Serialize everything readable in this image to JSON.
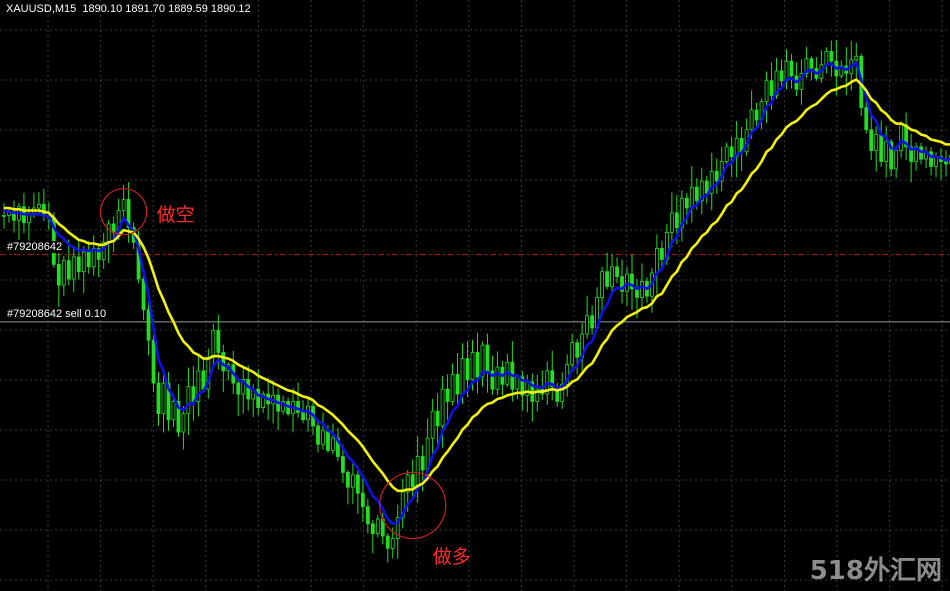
{
  "header": {
    "symbol": "XAUUSD,M15",
    "open": "1890.10",
    "high": "1891.70",
    "low": "1889.59",
    "close": "1890.12"
  },
  "orders": [
    {
      "label": "#79208642",
      "value": 1891.0,
      "color": "#b01010",
      "style": "dash-dot"
    },
    {
      "label": "#79208642 sell 0.10",
      "value": 1885.5,
      "color": "#9a9a9a",
      "style": "solid"
    }
  ],
  "annotations": [
    {
      "text": "做空",
      "x_index": 24,
      "y": 1894.5
    },
    {
      "text": "做多",
      "x_index": 82,
      "y": 1870.5
    }
  ],
  "watermark": "518外汇网",
  "chart_data": {
    "type": "candlestick",
    "instrument": "XAUUSD",
    "timeframe": "M15",
    "ylim": [
      1864,
      1910
    ],
    "grid": true,
    "bull_color": "#22dd22",
    "bear_color": "#22dd22",
    "grid_color": "#3a3a3a",
    "x": [
      0,
      1,
      2,
      3,
      4,
      5,
      6,
      7,
      8,
      9,
      10,
      11,
      12,
      13,
      14,
      15,
      16,
      17,
      18,
      19,
      20,
      21,
      22,
      23,
      24,
      25,
      26,
      27,
      28,
      29,
      30,
      31,
      32,
      33,
      34,
      35,
      36,
      37,
      38,
      39,
      40,
      41,
      42,
      43,
      44,
      45,
      46,
      47,
      48,
      49,
      50,
      51,
      52,
      53,
      54,
      55,
      56,
      57,
      58,
      59,
      60,
      61,
      62,
      63,
      64,
      65,
      66,
      67,
      68,
      69,
      70,
      71,
      72,
      73,
      74,
      75,
      76,
      77,
      78,
      79,
      80,
      81,
      82,
      83,
      84,
      85,
      86,
      87,
      88,
      89,
      90,
      91,
      92,
      93,
      94,
      95,
      96,
      97,
      98,
      99,
      100,
      101,
      102,
      103,
      104,
      105,
      106,
      107,
      108,
      109,
      110,
      111,
      112,
      113,
      114,
      115,
      116,
      117,
      118,
      119,
      120,
      121,
      122,
      123,
      124,
      125,
      126,
      127,
      128,
      129,
      130,
      131,
      132,
      133,
      134,
      135,
      136,
      137,
      138,
      139,
      140,
      141,
      142,
      143,
      144,
      145,
      146,
      147,
      148,
      149,
      150,
      151,
      152,
      153,
      154,
      155,
      156,
      157,
      158,
      159,
      160,
      161,
      162,
      163,
      164,
      165,
      166,
      167,
      168,
      169,
      170,
      171,
      172,
      173,
      174,
      175,
      176,
      177,
      178,
      179,
      180,
      181,
      182,
      183,
      184,
      185,
      186,
      187,
      188
    ],
    "close": [
      1894.2,
      1894.5,
      1893.8,
      1894.9,
      1893.6,
      1894.3,
      1894.8,
      1895.1,
      1894.2,
      1894.0,
      1890.2,
      1888.5,
      1890.5,
      1889.0,
      1890.8,
      1889.6,
      1891.2,
      1890.0,
      1891.5,
      1890.6,
      1892.0,
      1893.5,
      1892.8,
      1894.6,
      1895.5,
      1893.2,
      1892.0,
      1889.0,
      1886.5,
      1884.0,
      1880.5,
      1878.0,
      1880.5,
      1877.5,
      1879.0,
      1876.5,
      1878.0,
      1880.2,
      1879.0,
      1881.5,
      1880.0,
      1882.6,
      1884.8,
      1883.0,
      1881.5,
      1882.0,
      1880.5,
      1879.6,
      1880.8,
      1879.2,
      1880.0,
      1878.5,
      1879.6,
      1878.8,
      1879.5,
      1878.2,
      1879.0,
      1878.0,
      1879.0,
      1878.1,
      1877.5,
      1878.6,
      1877.0,
      1875.5,
      1876.6,
      1875.0,
      1876.0,
      1874.5,
      1873.2,
      1872.0,
      1873.0,
      1871.5,
      1870.4,
      1869.0,
      1868.2,
      1869.4,
      1868.0,
      1867.0,
      1867.8,
      1869.5,
      1871.6,
      1873.0,
      1872.0,
      1874.5,
      1873.4,
      1876.0,
      1878.2,
      1877.0,
      1880.0,
      1879.0,
      1881.2,
      1879.6,
      1882.5,
      1880.8,
      1883.0,
      1881.0,
      1883.6,
      1881.5,
      1880.0,
      1881.8,
      1880.4,
      1882.2,
      1880.0,
      1881.0,
      1879.5,
      1880.6,
      1879.0,
      1880.0,
      1879.6,
      1881.5,
      1880.2,
      1879.0,
      1880.4,
      1882.0,
      1883.8,
      1882.6,
      1884.5,
      1886.0,
      1885.0,
      1887.5,
      1889.6,
      1888.4,
      1890.0,
      1889.2,
      1888.0,
      1889.4,
      1888.2,
      1887.5,
      1888.8,
      1887.6,
      1889.5,
      1891.5,
      1890.6,
      1892.8,
      1894.4,
      1893.2,
      1895.6,
      1894.8,
      1896.5,
      1895.4,
      1897.0,
      1896.0,
      1897.8,
      1897.0,
      1898.6,
      1899.8,
      1899.0,
      1900.5,
      1899.4,
      1901.2,
      1902.8,
      1902.0,
      1903.5,
      1905.2,
      1904.0,
      1906.0,
      1905.2,
      1906.8,
      1905.6,
      1904.5,
      1905.8,
      1907.0,
      1906.2,
      1905.4,
      1906.5,
      1907.6,
      1906.8,
      1905.6,
      1906.4,
      1905.8,
      1906.9,
      1907.2,
      1903.0,
      1901.2,
      1899.5,
      1900.8,
      1898.6,
      1900.2,
      1898.0,
      1899.5,
      1901.6,
      1899.8,
      1898.6,
      1899.8,
      1898.8,
      1899.4,
      1898.2,
      1899.0,
      1898.6,
      1898.4,
      1899.1
    ],
    "series": [
      {
        "name": "",
        "color": "#1010e8",
        "values": [
          1894.6,
          1894.5,
          1894.4,
          1894.4,
          1894.3,
          1894.3,
          1894.3,
          1894.3,
          1894.2,
          1894.1,
          1893.2,
          1892.6,
          1892.3,
          1891.8,
          1891.6,
          1891.3,
          1891.4,
          1891.3,
          1891.4,
          1891.3,
          1891.5,
          1892.0,
          1892.2,
          1893.0,
          1894.0,
          1893.4,
          1892.9,
          1891.5,
          1889.6,
          1887.7,
          1885.0,
          1882.4,
          1881.5,
          1880.0,
          1879.4,
          1878.5,
          1878.3,
          1878.8,
          1878.8,
          1879.6,
          1879.8,
          1880.6,
          1881.9,
          1882.4,
          1882.0,
          1881.8,
          1881.3,
          1880.8,
          1880.6,
          1880.2,
          1880.0,
          1879.5,
          1879.4,
          1879.2,
          1879.1,
          1878.9,
          1878.8,
          1878.6,
          1878.5,
          1878.4,
          1878.2,
          1878.2,
          1877.9,
          1877.4,
          1877.2,
          1876.6,
          1876.4,
          1875.8,
          1875.2,
          1874.5,
          1874.1,
          1873.5,
          1872.9,
          1872.1,
          1871.3,
          1870.9,
          1870.2,
          1869.4,
          1869.0,
          1869.1,
          1869.8,
          1870.6,
          1871.0,
          1871.9,
          1872.3,
          1873.3,
          1874.6,
          1875.2,
          1876.6,
          1877.2,
          1878.2,
          1878.6,
          1879.6,
          1879.9,
          1880.6,
          1880.7,
          1881.4,
          1881.4,
          1881.1,
          1881.3,
          1881.1,
          1881.4,
          1881.1,
          1881.1,
          1880.7,
          1880.7,
          1880.3,
          1880.2,
          1880.1,
          1880.5,
          1880.4,
          1880.1,
          1880.2,
          1880.7,
          1881.6,
          1881.9,
          1882.7,
          1883.6,
          1883.9,
          1885.0,
          1886.3,
          1886.9,
          1887.9,
          1888.3,
          1888.2,
          1888.6,
          1888.5,
          1888.2,
          1888.4,
          1888.2,
          1888.6,
          1889.5,
          1889.8,
          1890.8,
          1892.0,
          1892.4,
          1893.5,
          1894.0,
          1894.9,
          1895.0,
          1895.7,
          1895.8,
          1896.5,
          1896.7,
          1897.4,
          1898.3,
          1898.5,
          1899.2,
          1899.3,
          1900.0,
          1901.0,
          1901.3,
          1902.0,
          1903.1,
          1903.4,
          1904.3,
          1904.6,
          1905.3,
          1905.4,
          1905.1,
          1905.4,
          1906.0,
          1906.1,
          1905.8,
          1906.0,
          1906.5,
          1906.6,
          1906.2,
          1906.3,
          1906.1,
          1906.4,
          1906.7,
          1905.2,
          1903.9,
          1902.4,
          1901.9,
          1900.8,
          1900.6,
          1899.7,
          1899.6,
          1900.3,
          1900.1,
          1899.6,
          1899.7,
          1899.4,
          1899.4,
          1899.0,
          1899.0,
          1898.9,
          1898.7,
          1898.8
        ]
      },
      {
        "name": "",
        "color": "#f2f20a",
        "values": [
          1894.8,
          1894.8,
          1894.7,
          1894.7,
          1894.6,
          1894.6,
          1894.6,
          1894.6,
          1894.5,
          1894.4,
          1894.0,
          1893.5,
          1893.2,
          1892.8,
          1892.5,
          1892.2,
          1892.1,
          1891.9,
          1891.9,
          1891.8,
          1891.8,
          1892.0,
          1892.1,
          1892.5,
          1893.0,
          1892.9,
          1892.8,
          1892.3,
          1891.6,
          1890.7,
          1889.5,
          1888.2,
          1887.3,
          1886.3,
          1885.5,
          1884.6,
          1883.9,
          1883.5,
          1883.0,
          1882.8,
          1882.5,
          1882.5,
          1882.7,
          1882.7,
          1882.6,
          1882.5,
          1882.3,
          1882.0,
          1881.8,
          1881.6,
          1881.4,
          1881.1,
          1880.9,
          1880.7,
          1880.5,
          1880.3,
          1880.1,
          1879.9,
          1879.8,
          1879.6,
          1879.4,
          1879.3,
          1879.1,
          1878.7,
          1878.5,
          1878.2,
          1877.9,
          1877.5,
          1877.1,
          1876.6,
          1876.2,
          1875.8,
          1875.3,
          1874.7,
          1874.1,
          1873.6,
          1873.1,
          1872.5,
          1872.0,
          1871.7,
          1871.7,
          1871.8,
          1871.8,
          1872.1,
          1872.3,
          1872.7,
          1873.3,
          1873.7,
          1874.4,
          1874.9,
          1875.5,
          1876.0,
          1876.7,
          1877.1,
          1877.7,
          1878.0,
          1878.5,
          1878.8,
          1878.9,
          1879.2,
          1879.3,
          1879.5,
          1879.6,
          1879.7,
          1879.7,
          1879.8,
          1879.7,
          1879.8,
          1879.8,
          1879.9,
          1880.0,
          1879.9,
          1880.0,
          1880.2,
          1880.6,
          1880.8,
          1881.3,
          1881.8,
          1882.1,
          1882.8,
          1883.6,
          1884.1,
          1884.8,
          1885.2,
          1885.5,
          1885.9,
          1886.1,
          1886.3,
          1886.6,
          1886.7,
          1887.0,
          1887.6,
          1887.8,
          1888.5,
          1889.2,
          1889.6,
          1890.4,
          1890.8,
          1891.5,
          1891.9,
          1892.5,
          1892.8,
          1893.4,
          1893.7,
          1894.3,
          1895.0,
          1895.3,
          1896.0,
          1896.3,
          1896.9,
          1897.6,
          1898.0,
          1898.6,
          1899.4,
          1899.7,
          1900.4,
          1900.8,
          1901.4,
          1901.7,
          1901.9,
          1902.3,
          1902.8,
          1903.1,
          1903.3,
          1903.7,
          1904.1,
          1904.4,
          1904.5,
          1904.7,
          1904.8,
          1905.1,
          1905.3,
          1904.9,
          1904.4,
          1903.7,
          1903.4,
          1902.8,
          1902.5,
          1902.0,
          1901.7,
          1901.7,
          1901.5,
          1901.2,
          1901.1,
          1900.8,
          1900.7,
          1900.4,
          1900.3,
          1900.2,
          1900.0,
          1900.0
        ]
      }
    ]
  }
}
